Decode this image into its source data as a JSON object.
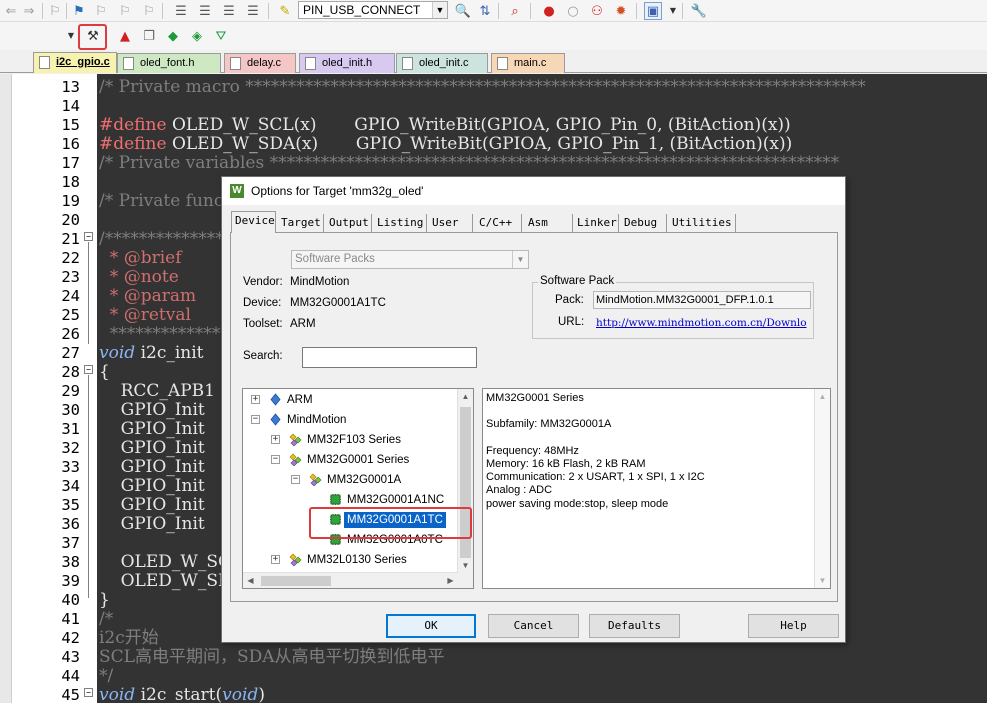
{
  "toolbar": {
    "target_name": "PIN_USB_CONNECT"
  },
  "file_tabs": [
    {
      "label": "i2c_gpio.c",
      "color": "#f7f2b0"
    },
    {
      "label": "oled_font.h",
      "color": "#cfe8c4"
    },
    {
      "label": "delay.c",
      "color": "#f4c6c6"
    },
    {
      "label": "oled_init.h",
      "color": "#d7c9ef"
    },
    {
      "label": "oled_init.c",
      "color": "#cde3de"
    },
    {
      "label": "main.c",
      "color": "#f6d7b6"
    }
  ],
  "code_lines": [
    {
      "n": "13",
      "text": "/* Private macro *************************************************************************"
    },
    {
      "n": "14",
      "text": ""
    },
    {
      "n": "15",
      "a": "#define",
      "b": " OLED_W_SCL(x)       GPIO_WriteBit(GPIOA, GPIO_Pin_0, (BitAction)(x))"
    },
    {
      "n": "16",
      "a": "#define",
      "b": " OLED_W_SDA(x)       GPIO_WriteBit(GPIOA, GPIO_Pin_1, (BitAction)(x))"
    },
    {
      "n": "17",
      "text": "/* Private variables *******************************************************************"
    },
    {
      "n": "18",
      "text": ""
    },
    {
      "n": "19",
      "text": "/* Private functions *******************************************************************"
    },
    {
      "n": "20",
      "text": ""
    },
    {
      "n": "21",
      "text": "/**************************************************************************************"
    },
    {
      "n": "22",
      "text": "  * @brief"
    },
    {
      "n": "23",
      "text": "  * @note"
    },
    {
      "n": "24",
      "text": "  * @param"
    },
    {
      "n": "25",
      "text": "  * @retval"
    },
    {
      "n": "26",
      "text": "  ************************************************************************************"
    },
    {
      "n": "27",
      "a": "void",
      "b": " i2c_init"
    },
    {
      "n": "28",
      "text": "{"
    },
    {
      "n": "29",
      "text": "    RCC_APB1"
    },
    {
      "n": "30",
      "text": "    GPIO_Init"
    },
    {
      "n": "31",
      "text": "    GPIO_Init"
    },
    {
      "n": "32",
      "text": "    GPIO_Init"
    },
    {
      "n": "33",
      "text": "    GPIO_Init"
    },
    {
      "n": "34",
      "text": "    GPIO_Init"
    },
    {
      "n": "35",
      "text": "    GPIO_Init"
    },
    {
      "n": "36",
      "text": "    GPIO_Init"
    },
    {
      "n": "37",
      "text": ""
    },
    {
      "n": "38",
      "text": "    OLED_W_SC"
    },
    {
      "n": "39",
      "text": "    OLED_W_SD"
    },
    {
      "n": "40",
      "text": "}"
    },
    {
      "n": "41",
      "text": "/*"
    },
    {
      "n": "42",
      "text": "i2c开始"
    },
    {
      "n": "43",
      "text": "SCL高电平期间，SDA从高电平切换到低电平"
    },
    {
      "n": "44",
      "text": "*/"
    },
    {
      "n": "45",
      "a": "void",
      "b": " i2c_start(",
      "c": "void",
      "d": ")"
    }
  ],
  "dialog": {
    "title": "Options for Target 'mm32g_oled'",
    "tabs": [
      "Device",
      "Target",
      "Output",
      "Listing",
      "User",
      "C/C++",
      "Asm",
      "Linker",
      "Debug",
      "Utilities"
    ],
    "software_packs_combo": "Software Packs",
    "vendor_label": "Vendor:",
    "vendor_value": "MindMotion",
    "device_label": "Device:",
    "device_value": "MM32G0001A1TC",
    "toolset_label": "Toolset:",
    "toolset_value": "ARM",
    "search_label": "Search:",
    "search_value": "",
    "software_pack": {
      "legend": "Software Pack",
      "pack_label": "Pack:",
      "pack_value": "MindMotion.MM32G0001_DFP.1.0.1",
      "url_label": "URL:",
      "url_value": "http://www.mindmotion.com.cn/Downlo"
    },
    "tree": [
      {
        "label": "ARM",
        "level": 0,
        "expander": "+",
        "icon": "diamond-icon"
      },
      {
        "label": "MindMotion",
        "level": 0,
        "expander": "-",
        "icon": "diamond-icon"
      },
      {
        "label": "MM32F103 Series",
        "level": 1,
        "expander": "+",
        "icon": "series-icon"
      },
      {
        "label": "MM32G0001 Series",
        "level": 1,
        "expander": "-",
        "icon": "series-icon"
      },
      {
        "label": "MM32G0001A",
        "level": 2,
        "expander": "-",
        "icon": "series-icon"
      },
      {
        "label": "MM32G0001A1NC",
        "level": 3,
        "expander": "",
        "icon": "chip-icon"
      },
      {
        "label": "MM32G0001A1TC",
        "level": 3,
        "expander": "",
        "icon": "chip-icon",
        "selected": true
      },
      {
        "label": "MM32G0001A0TC",
        "level": 3,
        "expander": "",
        "icon": "chip-icon"
      },
      {
        "label": "MM32L0130 Series",
        "level": 1,
        "expander": "+",
        "icon": "series-icon"
      }
    ],
    "description": "MM32G0001 Series\n\nSubfamily: MM32G0001A\n\nFrequency: 48MHz\nMemory: 16 kB Flash, 2 kB RAM\nCommunication: 2 x USART, 1 x SPI, 1 x I2C\nAnalog : ADC\npower saving mode:stop, sleep mode",
    "buttons": {
      "ok": "OK",
      "cancel": "Cancel",
      "defaults": "Defaults",
      "help": "Help"
    }
  },
  "colors": {
    "editor_bg": "#333333",
    "comment": "#7e7e7e",
    "keyword": "#8cb4f0",
    "preprocessor": "#f06f6f",
    "selection": "#0a64c8",
    "highlight": "#e0393e"
  }
}
